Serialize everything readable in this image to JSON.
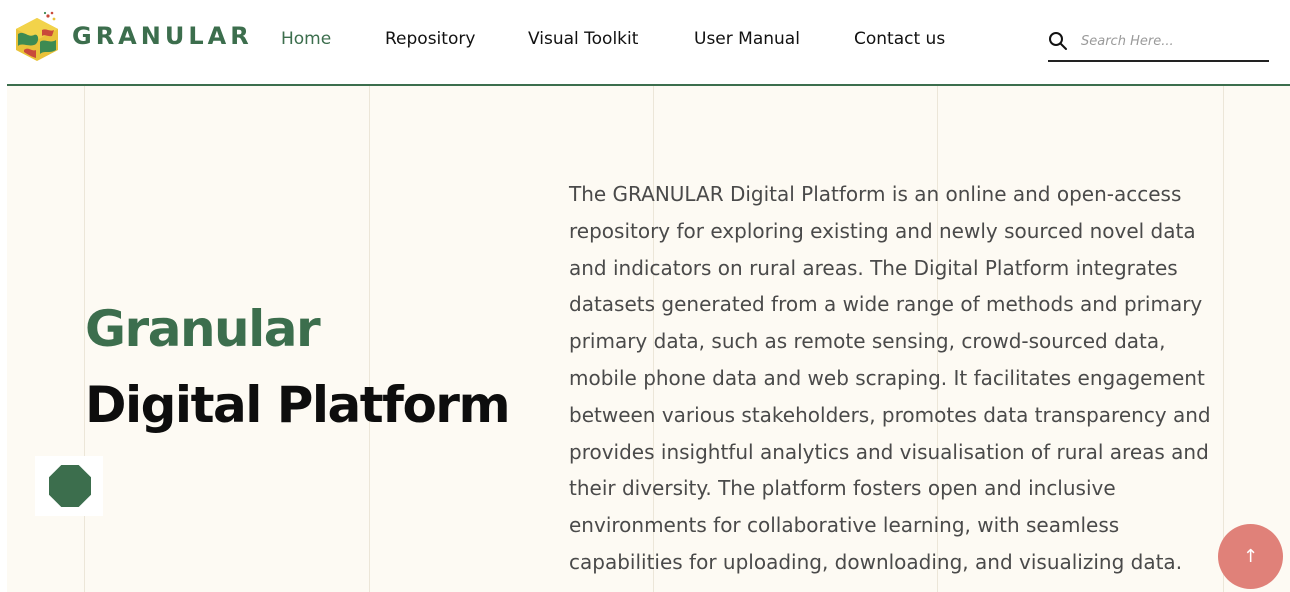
{
  "brand": {
    "name": "GRANULAR",
    "logo_icon": "granular-cube-logo"
  },
  "nav": {
    "items": [
      {
        "label": "Home",
        "active": true
      },
      {
        "label": "Repository",
        "active": false
      },
      {
        "label": "Visual Toolkit",
        "active": false
      },
      {
        "label": "User Manual",
        "active": false
      },
      {
        "label": "Contact us",
        "active": false
      }
    ]
  },
  "search": {
    "placeholder": "Search Here...",
    "value": "",
    "icon": "search-icon"
  },
  "hero": {
    "title_line1": "Granular",
    "title_line2": "Digital Platform",
    "description": "The GRANULAR Digital Platform is an online and open-access repository for exploring existing and newly sourced novel data and indicators on rural areas. The Digital Platform integrates datasets generated from a wide range of methods and primary primary data, such as remote sensing, crowd-sourced data, mobile phone data and web scraping. It facilitates engagement between various stakeholders, promotes data transparency and provides insightful analytics and visualisation of rural areas and their diversity. The platform fosters open and inclusive environments for collaborative learning, with seamless capabilities for uploading, downloading, and visualizing data."
  },
  "scroll_top": {
    "icon": "arrow-up-icon",
    "glyph": "↑"
  },
  "colors": {
    "accent_green": "#3c6e4d",
    "hero_bg": "#fdfaf3",
    "scroll_button": "#e08179",
    "text_dark": "#0d0d0d",
    "text_body": "#4a4a4a"
  }
}
